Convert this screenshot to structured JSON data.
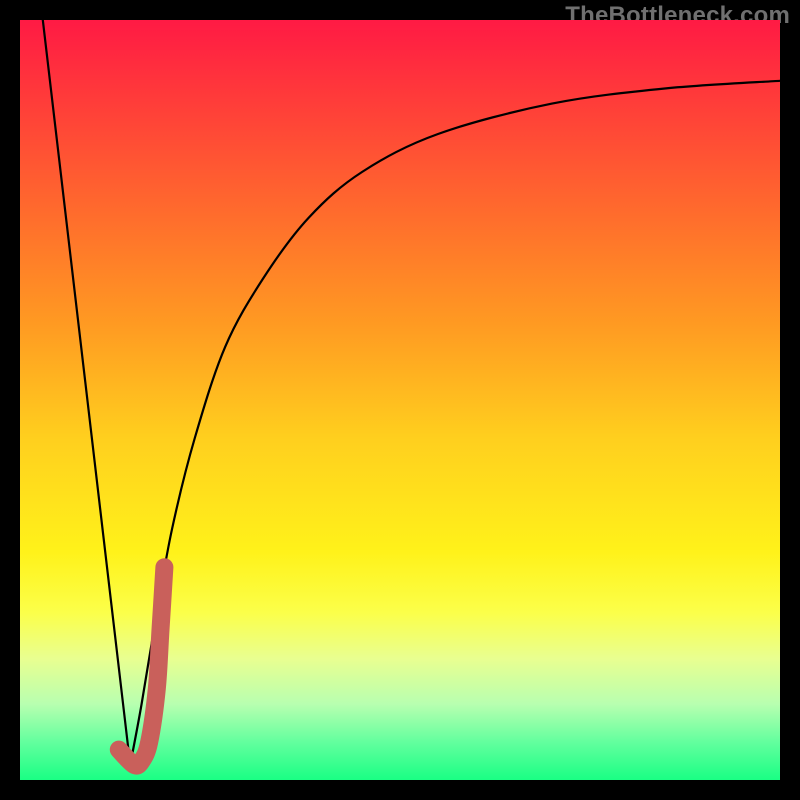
{
  "watermark": "TheBottleneck.com",
  "colors": {
    "frame": "#000000",
    "curve_stroke": "#000000",
    "marker_stroke": "#c9605b",
    "gradient_stops": [
      {
        "offset": 0.0,
        "color": "#ff1a44"
      },
      {
        "offset": 0.1,
        "color": "#ff3a3a"
      },
      {
        "offset": 0.25,
        "color": "#ff6a2d"
      },
      {
        "offset": 0.4,
        "color": "#ff9a22"
      },
      {
        "offset": 0.55,
        "color": "#ffcf1e"
      },
      {
        "offset": 0.7,
        "color": "#fff21a"
      },
      {
        "offset": 0.78,
        "color": "#fbff4a"
      },
      {
        "offset": 0.84,
        "color": "#e9ff90"
      },
      {
        "offset": 0.9,
        "color": "#b8ffb0"
      },
      {
        "offset": 0.95,
        "color": "#63ff9e"
      },
      {
        "offset": 1.0,
        "color": "#1aff84"
      }
    ]
  },
  "chart_data": {
    "type": "line",
    "title": "",
    "xlabel": "",
    "ylabel": "",
    "xlim": [
      0,
      100
    ],
    "ylim": [
      0,
      100
    ],
    "grid": false,
    "series": [
      {
        "name": "left-slope",
        "x": [
          3,
          14.5
        ],
        "y": [
          100,
          2
        ]
      },
      {
        "name": "right-curve",
        "x": [
          14.5,
          16,
          18,
          20,
          23,
          27,
          32,
          38,
          45,
          55,
          70,
          85,
          100
        ],
        "y": [
          2,
          10,
          22,
          33,
          45,
          57,
          66,
          74,
          80,
          85,
          89,
          91,
          92
        ]
      },
      {
        "name": "marker-j",
        "x": [
          13,
          15,
          16,
          17,
          18,
          18.5,
          19
        ],
        "y": [
          4,
          2,
          2.5,
          5,
          12,
          20,
          28
        ]
      }
    ],
    "annotations": []
  }
}
